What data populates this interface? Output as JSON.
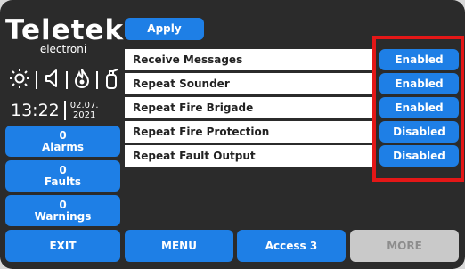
{
  "brand": {
    "logo": "Teletek",
    "sub": "electroni"
  },
  "status": {
    "time": "13:22",
    "date_line1": "02.07.",
    "date_line2": "2021"
  },
  "status_icons": [
    "sun-icon",
    "speaker-icon",
    "fire-icon",
    "extinguisher-icon"
  ],
  "left_buttons": {
    "alarms": {
      "count": "0",
      "label": "Alarms"
    },
    "faults": {
      "count": "0",
      "label": "Faults"
    },
    "warnings": {
      "count": "0",
      "label": "Warnings"
    }
  },
  "apply_label": "Apply",
  "settings": [
    {
      "label": "Receive Messages",
      "state": "Enabled"
    },
    {
      "label": "Repeat Sounder",
      "state": "Enabled"
    },
    {
      "label": "Repeat Fire Brigade",
      "state": "Enabled"
    },
    {
      "label": "Repeat Fire Protection",
      "state": "Disabled"
    },
    {
      "label": "Repeat Fault Output",
      "state": "Disabled"
    }
  ],
  "bottom": {
    "exit": "EXIT",
    "menu": "MENU",
    "access": "Access 3",
    "more": "MORE"
  },
  "colors": {
    "accent": "#1e7fe6",
    "background": "#2b2b2b",
    "highlight": "#e41717",
    "disabled": "#c9c9c9"
  }
}
